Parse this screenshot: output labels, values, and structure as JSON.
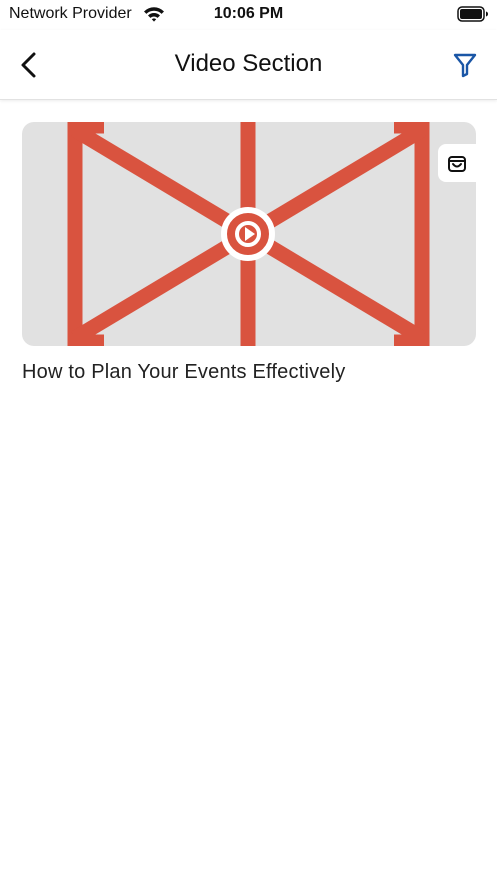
{
  "status_bar": {
    "carrier": "Network Provider",
    "time": "10:06 PM"
  },
  "nav": {
    "title": "Video Section",
    "accent_color": "#1a56a6"
  },
  "videos": [
    {
      "title": "How to Plan Your Events Effectively",
      "thumbnail_color": "#d9533f"
    }
  ]
}
